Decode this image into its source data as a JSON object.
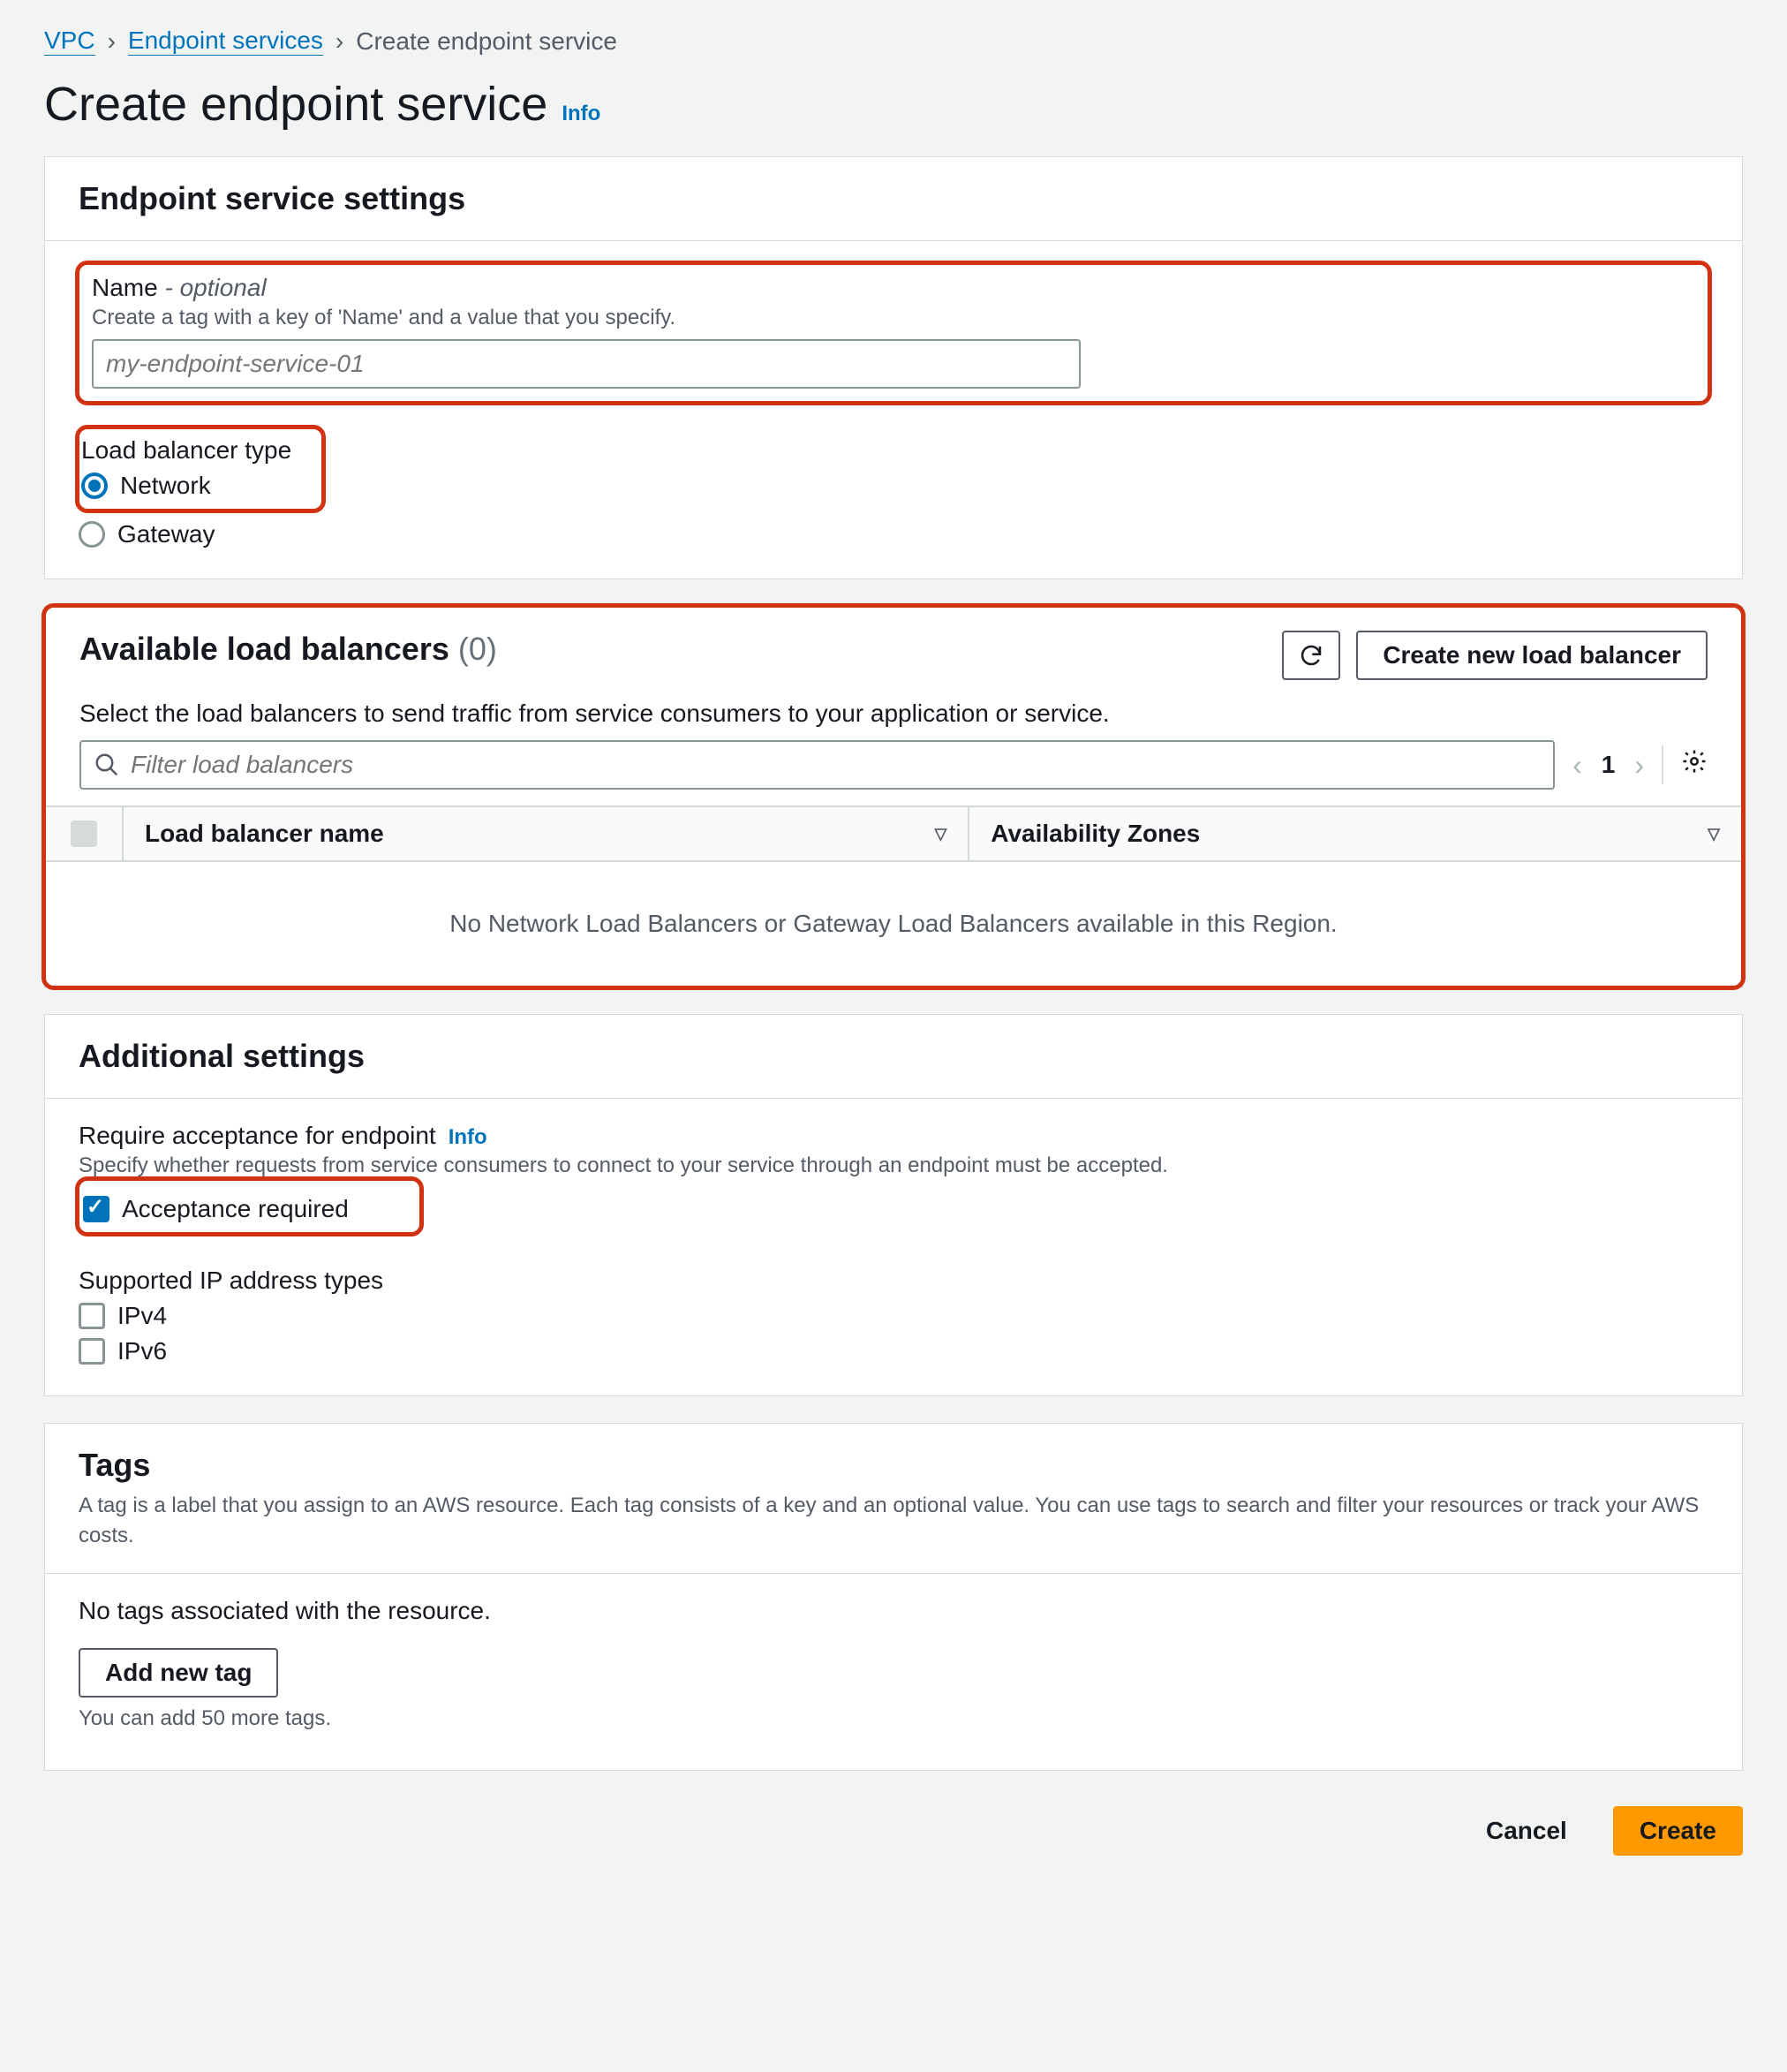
{
  "breadcrumb": {
    "vpc": "VPC",
    "endpoint_services": "Endpoint services",
    "current": "Create endpoint service"
  },
  "page": {
    "title": "Create endpoint service",
    "info": "Info"
  },
  "settings_panel": {
    "title": "Endpoint service settings",
    "name": {
      "label": "Name",
      "optional": "- optional",
      "desc": "Create a tag with a key of 'Name' and a value that you specify.",
      "placeholder": "my-endpoint-service-01"
    },
    "lb_type": {
      "label": "Load balancer type",
      "options": {
        "network": "Network",
        "gateway": "Gateway"
      }
    }
  },
  "lb_panel": {
    "title": "Available load balancers",
    "count": "(0)",
    "create_btn": "Create new load balancer",
    "desc": "Select the load balancers to send traffic from service consumers to your application or service.",
    "filter_placeholder": "Filter load balancers",
    "page": "1",
    "columns": {
      "name": "Load balancer name",
      "az": "Availability Zones"
    },
    "empty": "No Network Load Balancers or Gateway Load Balancers available in this Region."
  },
  "additional": {
    "title": "Additional settings",
    "require": {
      "label": "Require acceptance for endpoint",
      "info": "Info",
      "desc": "Specify whether requests from service consumers to connect to your service through an endpoint must be accepted.",
      "checkbox": "Acceptance required"
    },
    "ip": {
      "label": "Supported IP address types",
      "v4": "IPv4",
      "v6": "IPv6"
    }
  },
  "tags": {
    "title": "Tags",
    "desc": "A tag is a label that you assign to an AWS resource. Each tag consists of a key and an optional value. You can use tags to search and filter your resources or track your AWS costs.",
    "empty": "No tags associated with the resource.",
    "add_btn": "Add new tag",
    "limit": "You can add 50 more tags."
  },
  "footer": {
    "cancel": "Cancel",
    "create": "Create"
  }
}
